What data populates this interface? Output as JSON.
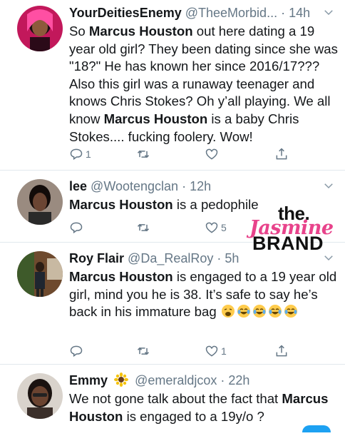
{
  "tweets": [
    {
      "name": "YourDeitiesEnemy",
      "handle": "@TheeMorbid...",
      "time": "· 14h",
      "text": [
        "So ",
        {
          "b": "Marcus Houston"
        },
        " out here dating a 19 year old girl? They been dating since she was \"18?\" He has known her since 2016/17??? Also this girl was a runaway teenager and knows Chris Stokes? Oh y’all playing. We all know ",
        {
          "b": "Marcus Houston"
        },
        " is a baby Chris Stokes.... fucking foolery. Wow!"
      ],
      "counts": {
        "reply": "1",
        "retweet": "",
        "like": ""
      }
    },
    {
      "name": "lee",
      "handle": "@Wootengclan",
      "time": "· 12h",
      "text": [
        {
          "b": "Marcus Houston"
        },
        " is a pedophile"
      ],
      "counts": {
        "reply": "",
        "retweet": "",
        "like": "5"
      }
    },
    {
      "name": "Roy Flair",
      "handle": "@Da_RealRoy",
      "time": "· 5h",
      "text": [
        {
          "b": "Marcus Houston"
        },
        " is engaged to a 19 year old girl, mind you he is 38. It’s safe to say he’s back in his immature bag "
      ],
      "emojis": [
        "weary",
        "joy",
        "joy",
        "joy",
        "joy"
      ],
      "counts": {
        "reply": "",
        "retweet": "",
        "like": "1"
      }
    },
    {
      "name": "Emmy",
      "name_emoji": "sunflower",
      "handle": "@emeraldjcox",
      "time": "· 22h",
      "text": [
        "We not gone talk about the fact that ",
        {
          "b": "Marcus Houston"
        },
        " is engaged to a 19y/o ?"
      ],
      "counts": {
        "reply": "",
        "retweet": "",
        "like": ""
      }
    }
  ],
  "watermark": {
    "line1": "the.",
    "line2": "Jasmine",
    "line3": "BRAND"
  },
  "colors": {
    "text": "#14171a",
    "secondary": "#657786",
    "divider": "#e1e8ed",
    "icon": "#657786",
    "accent": "#1da1f2",
    "watermark_pink": "#e8438b"
  },
  "icons": [
    "reply-icon",
    "retweet-icon",
    "like-icon",
    "share-icon",
    "chevron-down-icon"
  ]
}
